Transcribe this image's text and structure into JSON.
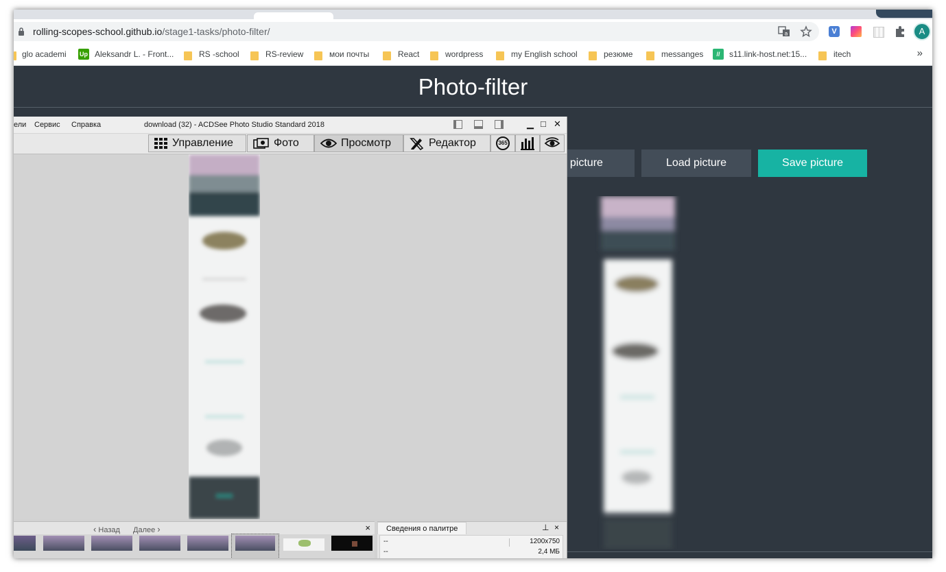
{
  "browser": {
    "url_domain": "rolling-scopes-school.github.io",
    "url_path": "/stage1-tasks/photo-filter/",
    "profile_initial": "A",
    "extension_v": "V",
    "bookmarks_more": "»",
    "bookmarks": [
      {
        "label": "glo academi",
        "icon": "folder-icon"
      },
      {
        "label": "Aleksandr L. - Front...",
        "icon": "upwork-icon",
        "badge": "Up"
      },
      {
        "label": "RS -school",
        "icon": "folder-icon"
      },
      {
        "label": "RS-review",
        "icon": "folder-icon"
      },
      {
        "label": "мои почты",
        "icon": "folder-icon"
      },
      {
        "label": "React",
        "icon": "folder-icon"
      },
      {
        "label": "wordpress",
        "icon": "folder-icon"
      },
      {
        "label": "my English school",
        "icon": "folder-icon"
      },
      {
        "label": "резюме",
        "icon": "folder-icon"
      },
      {
        "label": "messanges",
        "icon": "folder-icon"
      },
      {
        "label": "s11.link-host.net:15...",
        "icon": "host-icon",
        "badge": "//"
      },
      {
        "label": "itech",
        "icon": "folder-icon"
      }
    ]
  },
  "page": {
    "title": "Photo-filter",
    "buttons": {
      "next": "xt picture",
      "load": "Load picture",
      "save": "Save picture"
    },
    "colors": {
      "background": "#2f3740",
      "button": "#434d58",
      "accent": "#17b3a3"
    }
  },
  "acdsee": {
    "menu": [
      "ели",
      "Сервис",
      "Справка"
    ],
    "title": "download (32) - ACDSee Photo Studio Standard 2018",
    "modes": {
      "manage": "Управление",
      "photo": "Фото",
      "view": "Просмотр",
      "edit": "Редактор",
      "badge_365": "365"
    },
    "filmstrip": {
      "back": "Назад",
      "forward": "Далее",
      "close": "×"
    },
    "palette": {
      "tab": "Сведения о палитре",
      "pin": "⊥",
      "close": "×",
      "row1_left": "--",
      "row1_right": "1200x750",
      "row2_left": "--",
      "row2_right": "2,4 МБ"
    }
  }
}
